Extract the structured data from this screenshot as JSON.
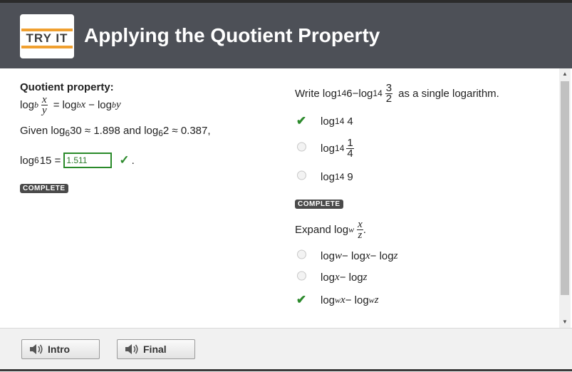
{
  "header": {
    "logo_text": "TRY IT",
    "title": "Applying the Quotient Property"
  },
  "left": {
    "heading": "Quotient property:",
    "formula": {
      "log": "log",
      "base": "b",
      "num": "x",
      "den": "y",
      "eq": "=",
      "t1log": "log",
      "t1base": "b",
      "t1arg": "x",
      "minus": "−",
      "t2log": "log",
      "t2base": "b",
      "t2arg": "y"
    },
    "given": {
      "prefix": "Given log",
      "base1": "6",
      "rest1": "30 ≈ 1.898 and log",
      "base2": "6",
      "rest2": "2 ≈ 0.387,"
    },
    "answer": {
      "log": "log",
      "base": "6",
      "arg": "15 =",
      "value": "1.511",
      "check": "✓",
      "period": "."
    },
    "status": "COMPLETE"
  },
  "right": {
    "q1": {
      "prefix": "Write log",
      "b1": "14",
      "mid": "6−log",
      "b2": "14",
      "num": "3",
      "den": "2",
      "suffix": "as a single logarithm."
    },
    "q1_options": [
      {
        "log": "log",
        "base": "14",
        "arg": "4",
        "selected": true
      },
      {
        "log": "log",
        "base": "14",
        "num": "1",
        "den": "4",
        "selected": false
      },
      {
        "log": "log",
        "base": "14",
        "arg": "9",
        "selected": false
      }
    ],
    "q1_status": "COMPLETE",
    "q2": {
      "prefix": "Expand log",
      "base": "w",
      "num": "x",
      "den": "z",
      "suffix": "."
    },
    "q2_options": [
      {
        "a": "log",
        "b": "w",
        "c": " − log",
        "d": "x",
        "e": " − log",
        "f": "z",
        "selected": false
      },
      {
        "a": "log",
        "b": "x",
        "c": " − log",
        "d": "z",
        "selected": false
      },
      {
        "a": "log",
        "b": "w",
        "c": "x",
        "d": " − log",
        "e": "w",
        "f": "z",
        "selected": true
      }
    ]
  },
  "footer": {
    "intro_label": "Intro",
    "final_label": "Final"
  },
  "colors": {
    "header_bg": "#4d5057",
    "accent": "#f0a030",
    "correct": "#2c8a2c"
  }
}
